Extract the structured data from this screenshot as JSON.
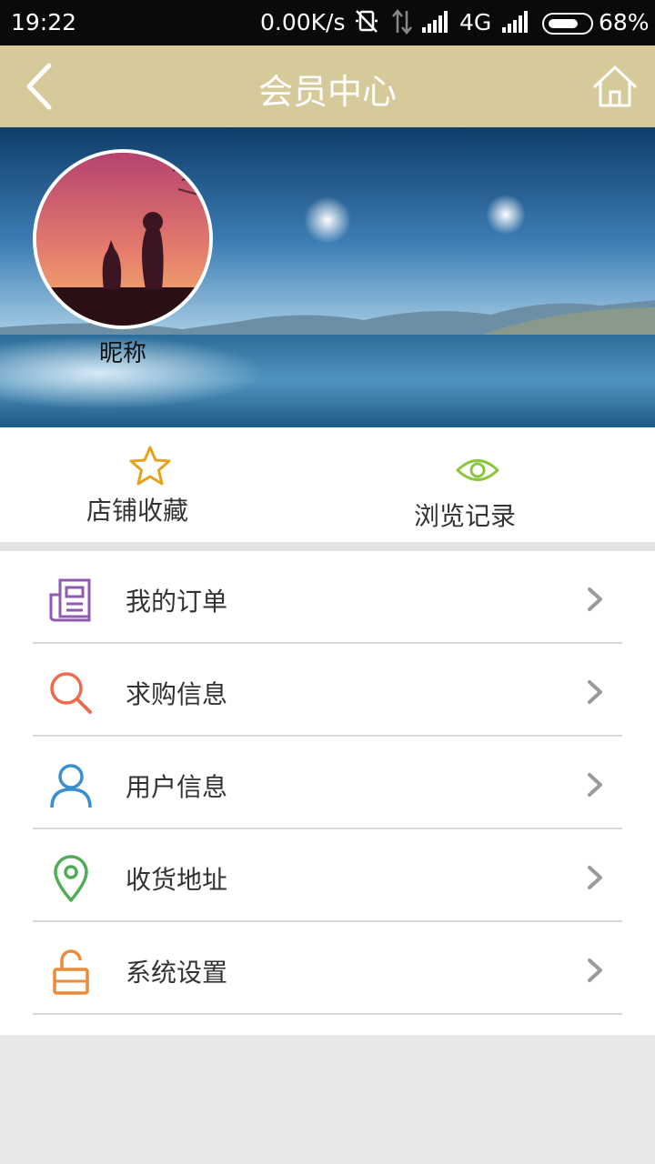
{
  "status_bar": {
    "time": "19:22",
    "net_speed": "0.00K/s",
    "network": "4G",
    "battery": "68%",
    "icons": [
      "mute-vibrate-icon",
      "data-transfer-icon",
      "signal-icon",
      "signal-icon",
      "battery-icon"
    ]
  },
  "header": {
    "title": "会员中心",
    "back_icon": "chevron-left-icon",
    "home_icon": "home-icon"
  },
  "profile": {
    "nickname": "昵称"
  },
  "quick_actions": [
    {
      "label": "店铺收藏",
      "icon": "star-icon",
      "color": "#e6a21c"
    },
    {
      "label": "浏览记录",
      "icon": "eye-icon",
      "color": "#8cc63e"
    }
  ],
  "menu": [
    {
      "label": "我的订单",
      "icon": "orders-icon",
      "color": "#8e5bb0"
    },
    {
      "label": "求购信息",
      "icon": "search-icon",
      "color": "#ee6a4f"
    },
    {
      "label": "用户信息",
      "icon": "user-icon",
      "color": "#3a8fd0"
    },
    {
      "label": "收货地址",
      "icon": "location-pin-icon",
      "color": "#4fae55"
    },
    {
      "label": "系统设置",
      "icon": "unlock-icon",
      "color": "#ea8c3c"
    }
  ],
  "colors": {
    "header_bg": "#d6c99a",
    "page_bg": "#e8e8e8",
    "chevron": "#9a9a9a"
  }
}
